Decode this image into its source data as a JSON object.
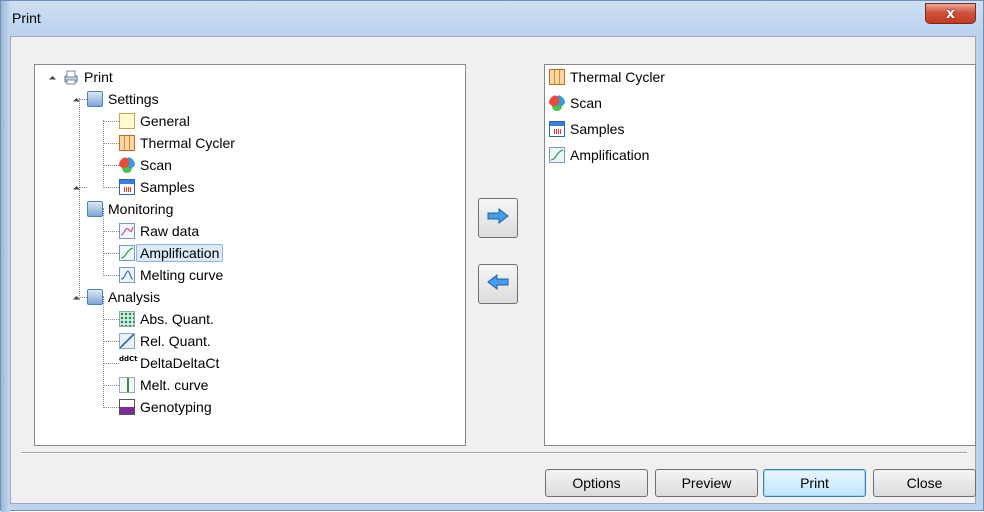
{
  "window": {
    "title": "Print",
    "close_glyph": "x"
  },
  "tree": {
    "root": {
      "label": "Print",
      "icon": "printer-icon"
    },
    "groups": [
      {
        "label": "Settings",
        "icon": "settings-icon",
        "children": [
          {
            "label": "General",
            "icon": "general-icon"
          },
          {
            "label": "Thermal Cycler",
            "icon": "thermal-cycler-icon"
          },
          {
            "label": "Scan",
            "icon": "scan-icon"
          },
          {
            "label": "Samples",
            "icon": "samples-icon"
          }
        ]
      },
      {
        "label": "Monitoring",
        "icon": "monitoring-icon",
        "children": [
          {
            "label": "Raw data",
            "icon": "raw-data-icon"
          },
          {
            "label": "Amplification",
            "icon": "amplification-icon",
            "selected": true
          },
          {
            "label": "Melting curve",
            "icon": "melting-curve-icon"
          }
        ]
      },
      {
        "label": "Analysis",
        "icon": "analysis-icon",
        "children": [
          {
            "label": "Abs. Quant.",
            "icon": "abs-quant-icon"
          },
          {
            "label": "Rel. Quant.",
            "icon": "rel-quant-icon"
          },
          {
            "label": "DeltaDeltaCt",
            "icon": "delta-delta-ct-icon",
            "icon_text": "ddCt"
          },
          {
            "label": "Melt. curve",
            "icon": "melt-curve-icon"
          },
          {
            "label": "Genotyping",
            "icon": "genotyping-icon"
          }
        ]
      }
    ]
  },
  "selected_list": [
    {
      "label": "Thermal Cycler",
      "icon": "thermal-cycler-icon"
    },
    {
      "label": "Scan",
      "icon": "scan-icon"
    },
    {
      "label": "Samples",
      "icon": "samples-icon"
    },
    {
      "label": "Amplification",
      "icon": "amplification-icon"
    }
  ],
  "transfer": {
    "add_icon": "arrow-right-icon",
    "remove_icon": "arrow-left-icon"
  },
  "buttons": {
    "options": "Options",
    "preview": "Preview",
    "print": "Print",
    "close": "Close"
  },
  "colors": {
    "arrow": "#2f7ed8",
    "selection": "#dbe9f9",
    "title_bar": "#bcd2ee",
    "close_button": "#c03a22"
  }
}
